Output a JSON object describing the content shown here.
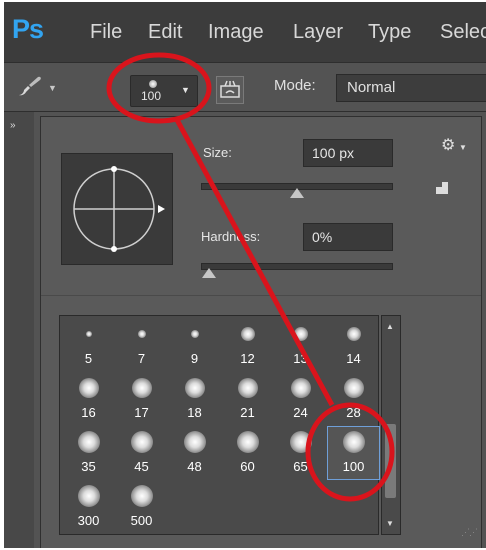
{
  "app": {
    "logo": "Ps",
    "menu": [
      "File",
      "Edit",
      "Image",
      "Layer",
      "Type",
      "Selec"
    ]
  },
  "options_bar": {
    "brush_preset_size": "100",
    "mode_label": "Mode:",
    "mode_value": "Normal"
  },
  "brush_picker": {
    "size_label": "Size:",
    "size_value": "100 px",
    "size_fraction": 0.5,
    "hardness_label": "Hardness:",
    "hardness_value": "0%",
    "hardness_fraction": 0.0,
    "presets": [
      "5",
      "7",
      "9",
      "12",
      "13",
      "14",
      "16",
      "17",
      "18",
      "21",
      "24",
      "28",
      "35",
      "45",
      "48",
      "60",
      "65",
      "100",
      "300",
      "500"
    ],
    "selected_preset": "100"
  },
  "annotation": {
    "color": "#d9141c"
  },
  "colors": {
    "menubar": "#3c3c3c",
    "panel": "#5a5a5a",
    "ps_blue": "#32a4f0"
  }
}
